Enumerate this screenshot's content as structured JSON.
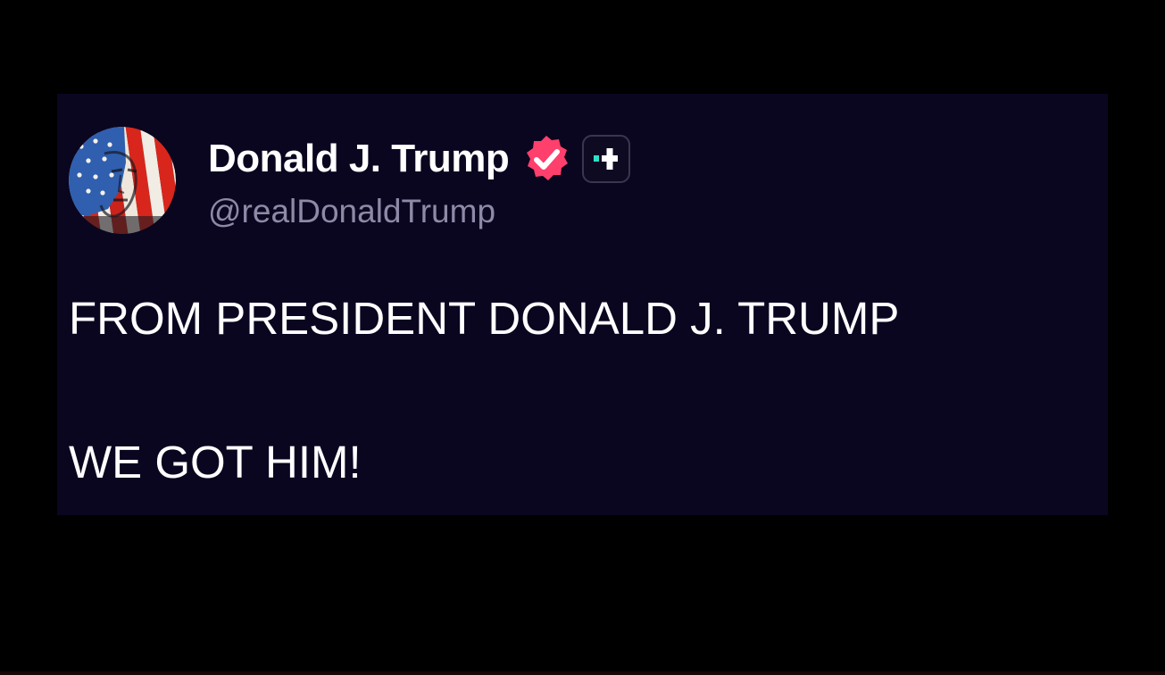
{
  "post": {
    "author": {
      "display_name": "Donald J. Trump",
      "handle": "@realDonaldTrump",
      "avatar_icon": "flag-face-avatar",
      "verified_icon": "verified-badge-icon",
      "plus_icon": "plus-badge-icon"
    },
    "body_lines": [
      "FROM PRESIDENT DONALD J. TRUMP",
      "WE GOT HIM!"
    ]
  },
  "colors": {
    "background": "#000000",
    "card_background": "#0a0620",
    "name_text": "#ffffff",
    "handle_text": "#8e89a6",
    "verified_badge": "#ff3f6c",
    "plus_accent": "#2fe0c8"
  }
}
